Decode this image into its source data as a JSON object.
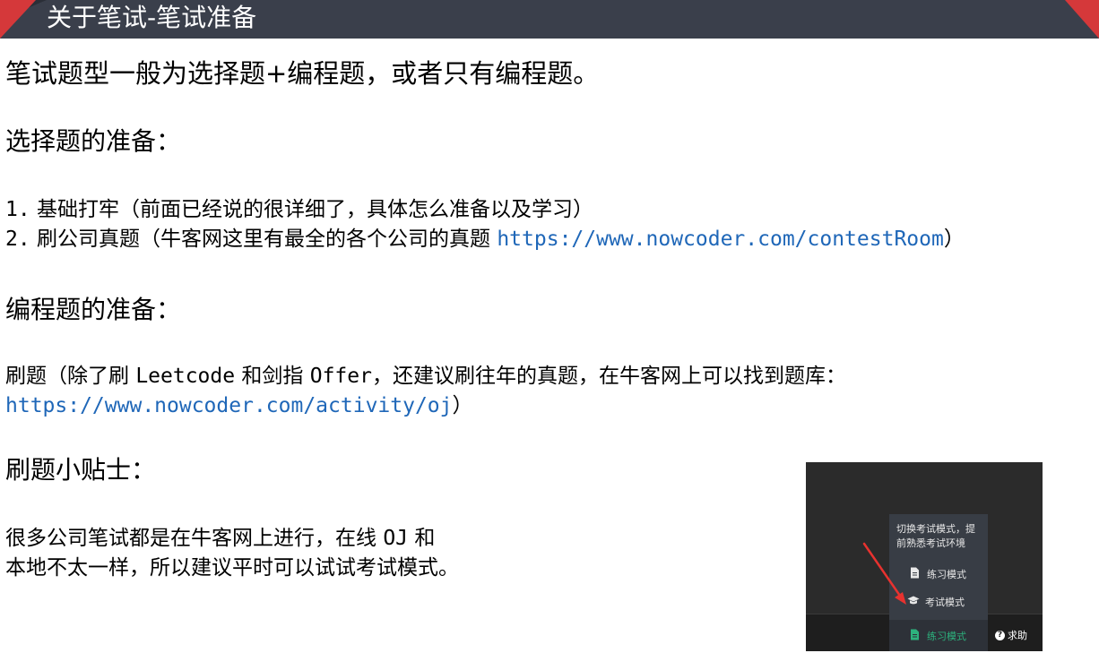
{
  "header": {
    "title": "关于笔试-笔试准备"
  },
  "content": {
    "lead": "笔试题型一般为选择题+编程题，或者只有编程题。",
    "choice_heading": "选择题的准备：",
    "choice_items": [
      {
        "num": "1.",
        "text": " 基础打牢（前面已经说的很详细了，具体怎么准备以及学习）"
      },
      {
        "num": "2.",
        "text": " 刷公司真题（牛客网这里有最全的各个公司的真题 ",
        "link": "https://www.nowcoder.com/contestRoom",
        "suffix": "）"
      }
    ],
    "coding_heading": "编程题的准备：",
    "coding_para": {
      "line1_a": "刷题（除了刷 ",
      "line1_b": "Leetcode",
      "line1_c": " 和剑指 ",
      "line1_d": "Offer",
      "line1_e": "，还建议刷往年的真题，在牛客网上可以找到题库：",
      "line2_link": "https://www.nowcoder.com/activity/oj",
      "line2_suffix": "）"
    },
    "tips_heading": "刷题小贴士：",
    "tips_para": {
      "line1_a": "很多公司笔试都是在牛客网上进行，在线 ",
      "line1_b": "OJ",
      "line1_c": " 和",
      "line2": "本地不太一样，所以建议平时可以试试考试模式。"
    }
  },
  "screenshot": {
    "tooltip": "切换考试模式，提前熟悉考试环境",
    "menu_items": [
      {
        "label": "练习模式",
        "icon": "file-icon"
      },
      {
        "label": "考试模式",
        "icon": "graduation-cap-icon"
      }
    ],
    "active_item": {
      "label": "练习模式",
      "icon": "file-icon"
    },
    "help_label": "求助",
    "colors": {
      "active": "#2db27d",
      "arrow": "#e8322f",
      "background": "#2b2b2b"
    }
  }
}
